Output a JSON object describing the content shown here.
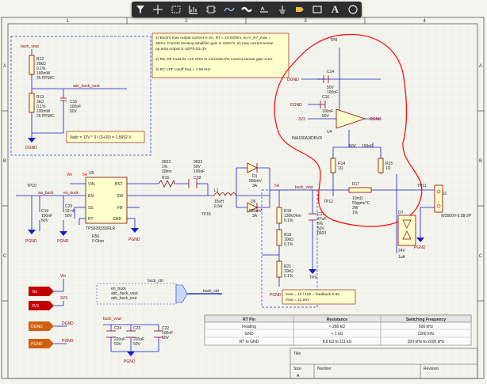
{
  "toolbar": {
    "tools": [
      {
        "name": "filter-icon"
      },
      {
        "name": "crosshair-icon"
      },
      {
        "name": "select-rect-icon"
      },
      {
        "name": "chart-icon"
      },
      {
        "name": "component-icon"
      },
      {
        "name": "wire-icon"
      },
      {
        "name": "bus-icon"
      },
      {
        "name": "net-label-icon"
      },
      {
        "name": "power-port-icon"
      },
      {
        "name": "port-icon"
      },
      {
        "name": "rectangle-icon"
      },
      {
        "name": "text-icon"
      },
      {
        "name": "circle-icon"
      }
    ],
    "text_tool_label": "A"
  },
  "border": {
    "cols": [
      "1",
      "2",
      "3",
      "4"
    ],
    "rows": [
      "A",
      "B",
      "C",
      "D"
    ]
  },
  "notes": {
    "main": [
      "1) Buck's max output current is 3A, R7 = 10 mOhm, so V_R7_max =",
      "30mV. Current sensing amplifier gain is 100V/V, so max current sense",
      "op amp output is 100*0.03=3V",
      "",
      "2) R6, R8 must be <10 Ohm to minimise the current sensor gain error",
      "",
      "3) RC LPF cutoff freq = 1.59 kHz"
    ],
    "vadc": "Vadc = 12V * 3 / (3+20) = 1.5652 V",
    "vout": [
      "Vout = 10 / 150 = feedback 0.8V",
      "Vout = 12.00V"
    ]
  },
  "nets": {
    "buck_vout": "buck_vout",
    "adc_buck_vout": "adc_buck_vout",
    "sw_buck": "sw_buck",
    "en_buck": "en_buck",
    "buck_ctrl": "buck_ctrl",
    "vin": "Vin",
    "v5a": "5A",
    "dgnd": "DGND",
    "pgnd": "PGND",
    "v3v3": "3V3",
    "bus_items": [
      "en_buck",
      "adc_buck_vout",
      "adc_buck_iout"
    ]
  },
  "components": {
    "r12": [
      "R12",
      "20kΩ",
      "0.1%",
      "100mW",
      "25 PPM/C"
    ],
    "r13": [
      "R13",
      "3kΩ",
      "0.1%",
      "100mW",
      "25 PPM/C"
    ],
    "c15": [
      "C15",
      "100nF",
      "50V"
    ],
    "tp10": "TP10",
    "c19": [
      "C19",
      "100nF",
      "50V"
    ],
    "c20": [
      "C20",
      "33 nF",
      "50V"
    ],
    "u5": {
      "ref": "U5",
      "part": "TPS62933DRLR",
      "pins_l": [
        "VIN",
        "EN",
        "SS",
        "RT"
      ],
      "pins_r": [
        "BST",
        "SW",
        "FB",
        "GND"
      ]
    },
    "r50": [
      "R50",
      "0 Ohm"
    ],
    "r16": [
      "0603",
      "1%",
      "20hm",
      "R16"
    ],
    "c18": [
      "0603",
      "50V",
      "100nF",
      "C18"
    ],
    "l1": [
      "L1",
      "15uH",
      "6.5A"
    ],
    "tp15": "TP15",
    "d1": [
      "D1",
      "550mV",
      "3A"
    ],
    "d6": [
      "D6",
      "550mV",
      "3A"
    ],
    "r18": [
      "R18",
      "130kOhm",
      "0.1%"
    ],
    "r19": [
      "R19",
      "10kΩ",
      "0.1%"
    ],
    "r21": [
      "R21",
      "10kΩ",
      "0.1%"
    ],
    "c21": [
      "C21",
      "47uF",
      "5%",
      "50V",
      "0603"
    ],
    "tp9": "TP9",
    "tp12": "TP12",
    "r17": [
      "R17",
      "10mΩ",
      "50ppm/°C",
      "2W",
      "1%"
    ],
    "tp11": "TP11",
    "j1": [
      "J1",
      "W3500V-5.08-2P"
    ],
    "d7": [
      "D7",
      "24V",
      "1uA"
    ],
    "tp8": "TP8",
    "c14": [
      "C14",
      "50V",
      "100nF"
    ],
    "c16": [
      "C16",
      "100nF",
      "50V"
    ],
    "u4": [
      "U4",
      "INA180A3IDBVR"
    ],
    "c17": [
      "50V",
      "100nF"
    ],
    "r14": [
      "R14",
      "1Ω"
    ],
    "r15": [
      "R15",
      "1Ω"
    ],
    "c24": [
      "C24",
      "220uF",
      "50V"
    ],
    "c23": [
      "C23",
      "220uF",
      "50V"
    ],
    "c22": [
      "C22",
      "100nF",
      "50V"
    ]
  },
  "rt_table": {
    "headers": [
      "RT Pin",
      "Resistance",
      "Switching Frequency"
    ],
    "rows": [
      [
        "Floating",
        "≈ 280 kΩ",
        "500 kHz"
      ],
      [
        "GND",
        "< 1 kΩ",
        "1200 kHz"
      ],
      [
        "RT to GND",
        "8.9 kΩ to 111 kΩ",
        "200 kHz to 2200 kHz"
      ]
    ]
  },
  "title_block": {
    "title": "Title",
    "size": "Size",
    "size_val": "A",
    "number": "Number",
    "revision": "Revision"
  },
  "colors": {
    "wire": "#1a1ac8",
    "body": "#ffffcc",
    "outline": "#8b0000",
    "note_bg": "#ffffcc",
    "port_red": "#c00000",
    "port_orange": "#d06010",
    "annotation": "#ff0000",
    "dashed": "#2040d0"
  }
}
